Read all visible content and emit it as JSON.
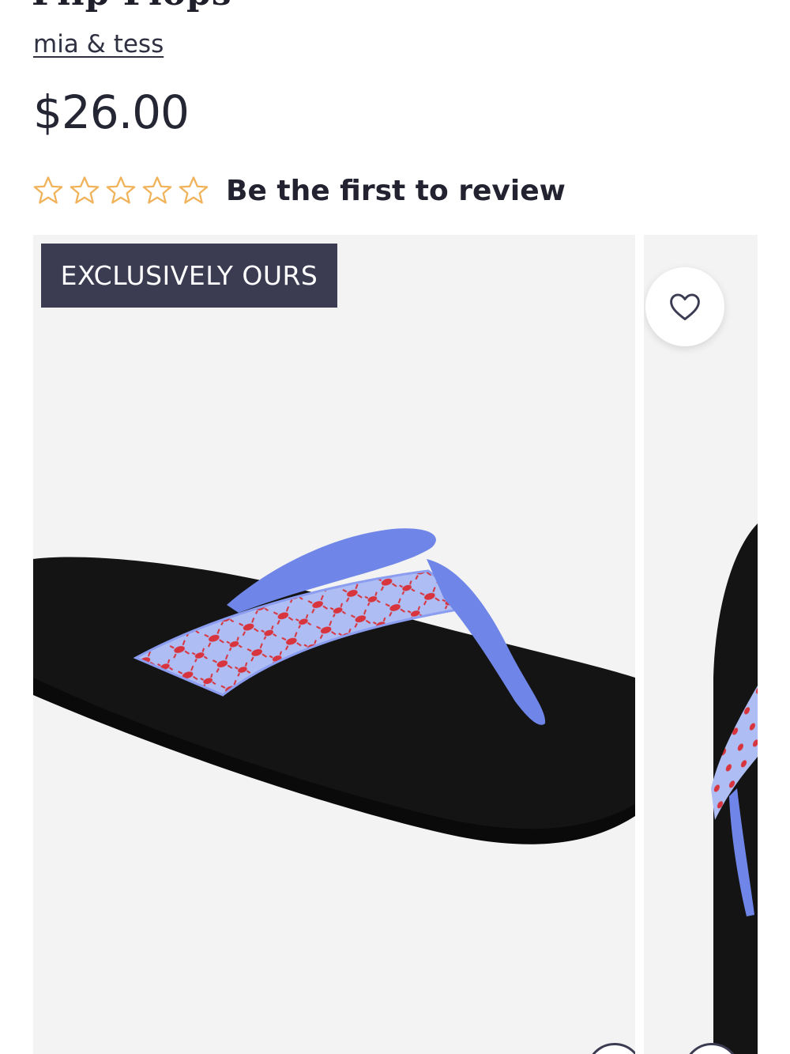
{
  "product": {
    "title": "Flip Flops",
    "brand": "mia & tess",
    "price": "$26.00",
    "rating": {
      "stars": 0,
      "max": 5,
      "review_prompt": "Be the first to review"
    },
    "badge": "EXCLUSIVELY OURS",
    "wishlist_icon": "heart-outline-icon"
  },
  "colors": {
    "badge_bg": "#3b3c52",
    "star_outline": "#f0b35a",
    "strap_blue": "#6f86e8",
    "print_red": "#d8343d",
    "sole": "#151515"
  }
}
